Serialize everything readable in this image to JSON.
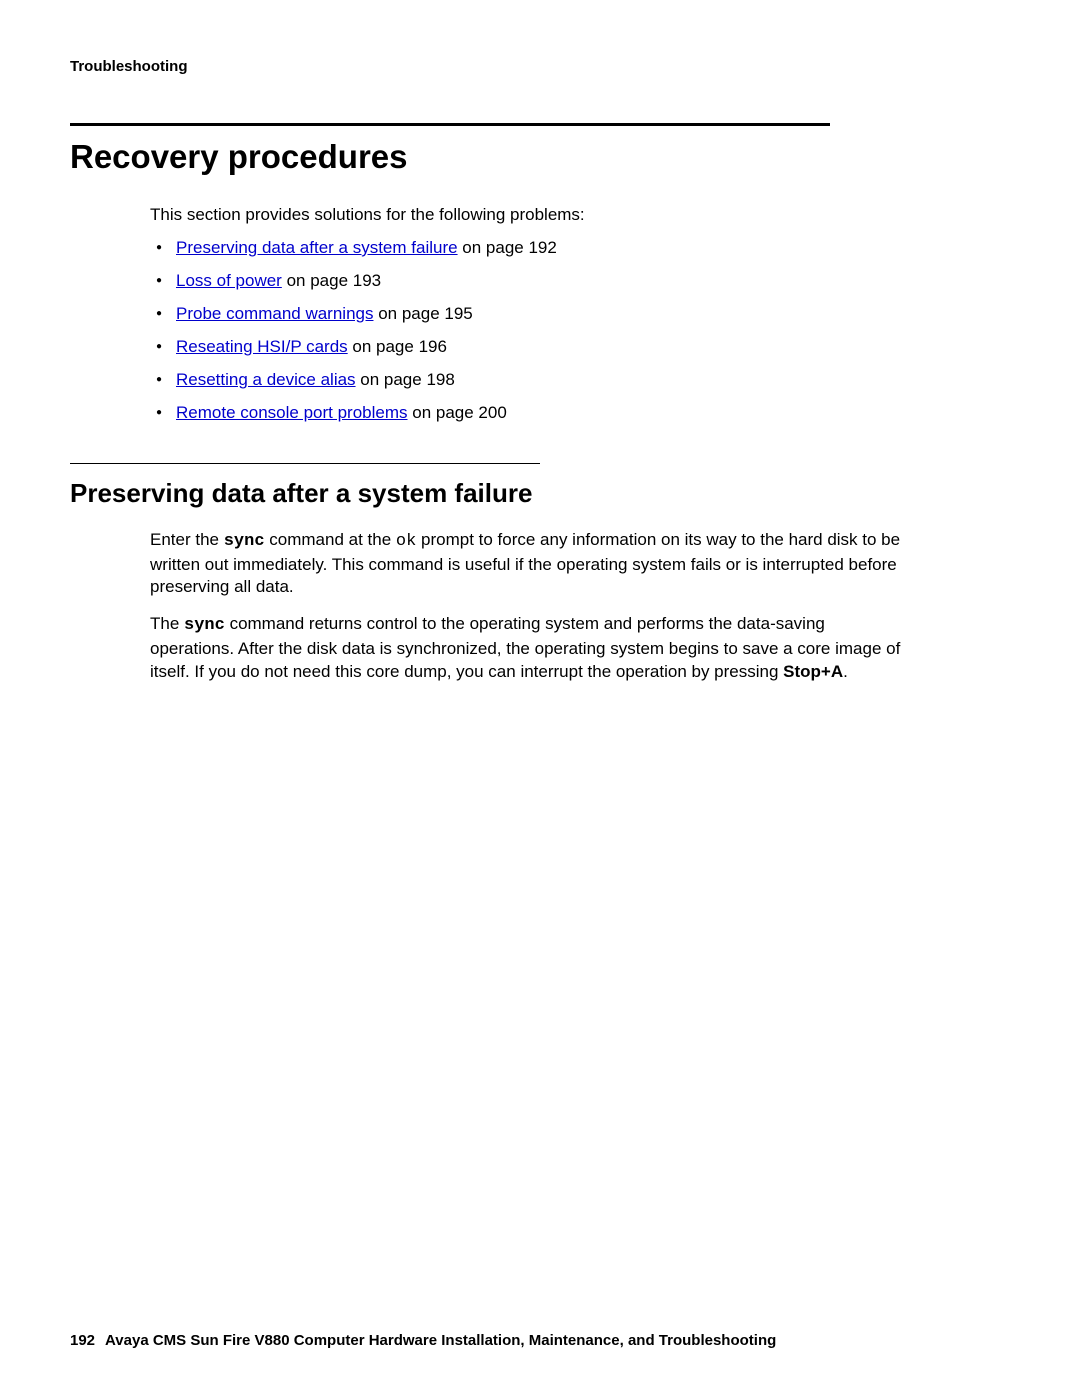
{
  "header": {
    "section": "Troubleshooting"
  },
  "main": {
    "title": "Recovery procedures",
    "intro": "This section provides solutions for the following problems:",
    "links": [
      {
        "text": "Preserving data after a system failure",
        "suffix": " on page 192"
      },
      {
        "text": "Loss of power",
        "suffix": " on page 193"
      },
      {
        "text": "Probe command warnings",
        "suffix": " on page 195"
      },
      {
        "text": "Reseating HSI/P cards",
        "suffix": " on page 196"
      },
      {
        "text": "Resetting a device alias",
        "suffix": " on page 198"
      },
      {
        "text": "Remote console port problems",
        "suffix": " on page 200"
      }
    ]
  },
  "sub": {
    "title": "Preserving data after a system failure",
    "p1_a": "Enter the ",
    "p1_cmd1": "sync",
    "p1_b": " command at the ",
    "p1_cmd2": "ok",
    "p1_c": " prompt to force any information on its way to the hard disk to be written out immediately. This command is useful if the operating system fails or is interrupted before preserving all data.",
    "p2_a": "The ",
    "p2_cmd": "sync",
    "p2_b": " command returns control to the operating system and performs the data-saving operations. After the disk data is synchronized, the operating system begins to save a core image of itself. If you do not need this core dump, you can interrupt the operation by pressing ",
    "p2_key": "Stop+A",
    "p2_c": "."
  },
  "footer": {
    "page": "192",
    "title": "Avaya CMS Sun Fire V880 Computer Hardware Installation, Maintenance, and Troubleshooting"
  }
}
